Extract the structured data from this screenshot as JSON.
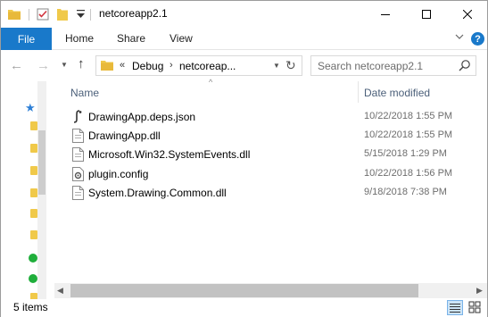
{
  "window": {
    "title": "netcoreapp2.1"
  },
  "quick_access": {
    "items": [
      "folder-icon",
      "properties-icon",
      "new-folder-icon",
      "customize-dropdown"
    ]
  },
  "ribbon": {
    "tabs": [
      {
        "label": "File",
        "active": true
      },
      {
        "label": "Home"
      },
      {
        "label": "Share"
      },
      {
        "label": "View"
      }
    ],
    "help_label": "?"
  },
  "navigation": {
    "breadcrumb_overflow": "«",
    "breadcrumbs": [
      "Debug",
      "netcoreap..."
    ],
    "search_placeholder": "Search netcoreapp2.1"
  },
  "file_list": {
    "columns": [
      "Name",
      "Date modified"
    ],
    "files": [
      {
        "name": "DrawingApp.deps.json",
        "date_modified": "10/22/2018 1:55 PM",
        "icon": "json-file-icon"
      },
      {
        "name": "DrawingApp.dll",
        "date_modified": "10/22/2018 1:55 PM",
        "icon": "dll-file-icon"
      },
      {
        "name": "Microsoft.Win32.SystemEvents.dll",
        "date_modified": "5/15/2018 1:29 PM",
        "icon": "dll-file-icon"
      },
      {
        "name": "plugin.config",
        "date_modified": "10/22/2018 1:56 PM",
        "icon": "config-file-icon"
      },
      {
        "name": "System.Drawing.Common.dll",
        "date_modified": "9/18/2018 7:38 PM",
        "icon": "dll-file-icon"
      }
    ]
  },
  "status": {
    "item_count": "5 items"
  },
  "colors": {
    "accent": "#1979ca",
    "header_text": "#4c607a",
    "folder_yellow": "#f0c94a"
  }
}
